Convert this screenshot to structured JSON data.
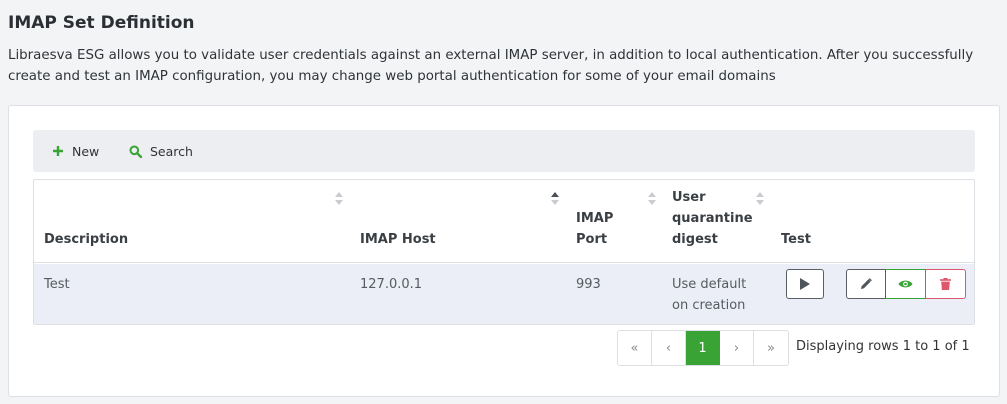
{
  "page": {
    "title": "IMAP Set Definition",
    "description": "Libraesva ESG allows you to validate user credentials against an external IMAP server, in addition to local authentication. After you successfully create and test an IMAP configuration, you may change web portal authentication for some of your email domains"
  },
  "toolbar": {
    "new_label": "New",
    "search_label": "Search"
  },
  "table": {
    "columns": {
      "description": "Description",
      "host": "IMAP Host",
      "port_line1": "IMAP",
      "port_line2": "Port",
      "digest_line1": "User",
      "digest_line2": "quarantine",
      "digest_line3": "digest",
      "test": "Test"
    },
    "rows": [
      {
        "description": "Test",
        "host": "127.0.0.1",
        "port": "993",
        "digest_line1": "Use default",
        "digest_line2": "on creation"
      }
    ]
  },
  "pagination": {
    "first": "«",
    "prev": "‹",
    "current": "1",
    "next": "›",
    "last": "»",
    "info": "Displaying rows 1 to 1 of 1"
  },
  "colors": {
    "accent_green": "#3aa335",
    "danger_red": "#e0566a",
    "row_bg": "#ebeef6"
  }
}
